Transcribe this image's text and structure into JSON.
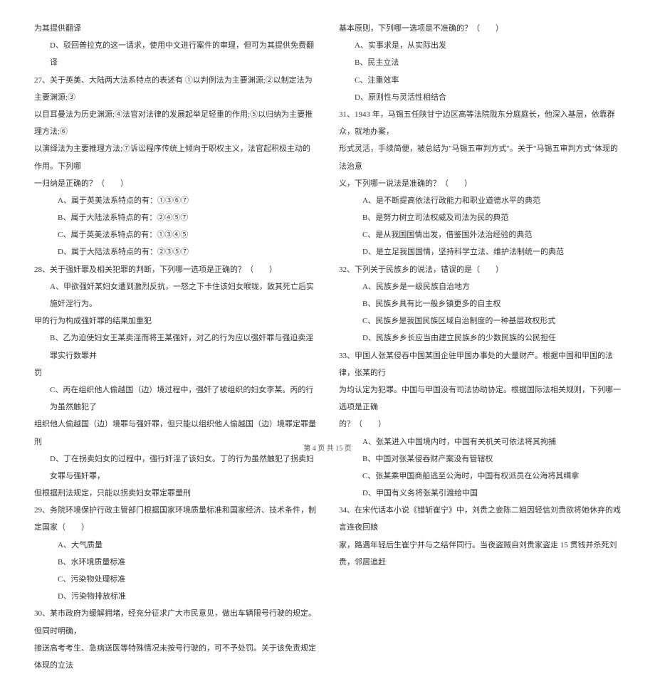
{
  "left": {
    "l0": "为其提供翻译",
    "l1": "D、驳回普拉克的这一请求，使用中文进行案件的审理，但可为其提供免费翻译",
    "l2": "27、关于英美、大陆两大法系特点的表述有 ①以判例法为主要渊源;②以制定法为主要渊源;③",
    "l3": "以目耳曼法为历史渊源;④法官对法律的发展起举足轻重的作用;⑤以归纳为主要推理方法;⑥",
    "l4": "以演绎法为主要推理方法;⑦诉讼程序传统上倾向于职权主义，法官起积极主动的作用。下列哪",
    "l5": "一归纳是正确的？（　　）",
    "l6": "A、属于英美法系特点的有：①③⑥⑦",
    "l7": "B、属于大陆法系特点的有：②④⑤⑦",
    "l8": "C、属于英美法系特点的有：①③④⑤",
    "l9": "D、属于大陆法系特点的有：②③⑤⑦",
    "l10": "28、关于强奸罪及相关犯罪的判断，下列哪一选项是正确的？（　　）",
    "l11": "A、甲欲强奸某妇女遭到激烈反抗，一怒之下卡住该妇女喉咙，致其死亡后实施奸淫行为。",
    "l12": "甲的行为构成强奸罪的结果加重犯",
    "l13": "B、乙为迫使妇女王某卖淫而将王某强奸，对乙的行为应以强奸罪与强迫卖淫罪实行数罪并",
    "l14": "罚",
    "l15": "C、丙在组织他人偷越国（边）境过程中，强奸了被组织的妇女李某。丙的行为虽然触犯了",
    "l16": "组织他人偷越国（边）境罪与强奸罪，但只能以组织他人偷越国（边）境罪定罪量刑",
    "l17": "D、丁在拐卖妇女的过程中，强行奸淫了该妇女。丁的行为虽然触犯了拐卖妇女罪与强奸罪，",
    "l18": "但根据刑法规定，只能以拐卖妇女罪定罪量刑",
    "l19": "29、务院环境保护行政主管部门根据国家环境质量标准和国家经济、技术条件，制定国家（　　）",
    "l20": "A、大气质量",
    "l21": "B、水环境质量标准",
    "l22": "C、污染物处理标准",
    "l23": "D、污染物排放标准",
    "l24": "30、某市政府为缓解拥堵，经充分征求广大市民意见，做出车辆限号行驶的规定。但同时明确，",
    "l25": "接送高考考生、急病送医等特殊情况未按号行驶的，可不予处罚。关于该免责规定体现的立法"
  },
  "right": {
    "r0": "基本原则，下列哪一选项是不准确的？（　　）",
    "r1": "A、实事求是，从实际出发",
    "r2": "B、民主立法",
    "r3": "C、注重效率",
    "r4": "D、原则性与灵活性相结合",
    "r5": "31、1943 年，马锡五任陕甘宁边区高等法院陇东分庭庭长，他深入基层，依靠群众，就地办案，",
    "r6": "形式灵活，手续简便，被总结为\"马锡五审判方式\"。关于\"马锡五审判方式\"体现的法治意",
    "r7": "义，下列哪一说法是准确的？（　　）",
    "r8": "A、是不断提高依法行政能力和职业道德水平的典范",
    "r9": "B、是努力树立司法权威及司法为民的典范",
    "r10": "C、是从我国国情出发，借鉴国外法治经验的典范",
    "r11": "D、是立足我国国情，坚持科学立法、维护法制统一的典范",
    "r12": "32、下列关于民族乡的说法，错误的是（　　）",
    "r13": "A、民族乡是一级民族自治地方",
    "r14": "B、民族乡具有比一般乡镇更多的自主权",
    "r15": "C、民族乡是我国民族区域自治制度的一种基层政权形式",
    "r16": "D、民族乡乡长应当由建立民族乡的少数民族的公民担任",
    "r17": "33、甲国人张某侵吞中国某国企驻甲国办事处的大量财产。根据中国和甲国的法律，张某的行",
    "r18": "为均认定为犯罪。中国与甲国没有司法协助协定。根据国际法相关规则，下列哪一选项是正确",
    "r19": "的？（　　）",
    "r20": "A、张某进入中国境内时，中国有关机关可依法将其拘捕",
    "r21": "B、中国对张某侵吞财产案没有管辖权",
    "r22": "C、张某乘甲国商船逃至公海时，中国有权派员在公海将其缉拿",
    "r23": "D、甲国有义务将张某引渡给中国",
    "r24": "34、在宋代话本小说《错斩崔宁》中，刘贵之妾陈二姐因轻信刘贵欲将她休弃的戏言连夜回娘",
    "r25": "家，路遇年轻后生崔宁并与之结伴同行。当夜盗贼自刘贵家盗走 15 贯钱并杀死刘贵，邻居追赶"
  },
  "footer": "第 4 页 共 15 页"
}
